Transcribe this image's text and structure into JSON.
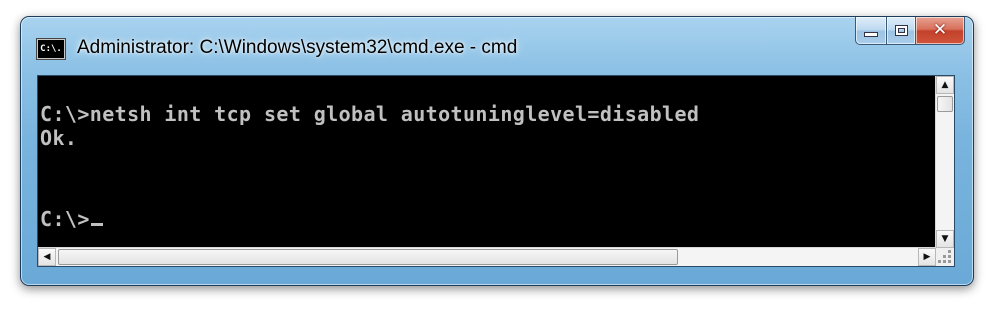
{
  "window": {
    "title": "Administrator: C:\\Windows\\system32\\cmd.exe - cmd",
    "icon_label": "C:\\.",
    "icon": "console-icon"
  },
  "caption_buttons": {
    "minimize_icon": "minimize-icon",
    "maximize_icon": "maximize-icon",
    "close_glyph": "✕"
  },
  "console": {
    "lines": [
      "C:\\>netsh int tcp set global autotuninglevel=disabled",
      "Ok.",
      "",
      "C:\\>"
    ],
    "background": "#000000",
    "foreground": "#c0c0c0"
  },
  "scrollbars": {
    "up_arrow": "▲",
    "down_arrow": "▼",
    "left_arrow": "◀",
    "right_arrow": "▶"
  }
}
